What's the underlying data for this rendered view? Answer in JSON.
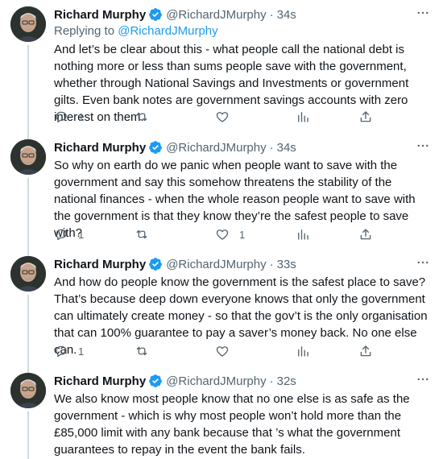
{
  "author": {
    "name": "Richard Murphy",
    "handle": "@RichardJMurphy"
  },
  "tweets": [
    {
      "time": "34s",
      "replying_label": "Replying to",
      "replying_to": "@RichardJMurphy",
      "text": "And let’s be clear about this - what people call the national debt is nothing more or less than sums people save with the government, whether through National Savings and Investments or government gilts. Even bank notes are government savings accounts with zero interest on them.",
      "replies": "1",
      "retweets": "",
      "likes": ""
    },
    {
      "time": "34s",
      "text": "So why on earth do we panic when people want to save with the government and say this somehow threatens the stability of the national finances - when the whole reason people want to save with the government is that they know they’re the safest people to save with?",
      "replies": "1",
      "retweets": "",
      "likes": "1"
    },
    {
      "time": "33s",
      "text": "And how do people know the government is the safest place to save? That’s because deep down everyone knows that only the government can ultimately create money - so that the gov’t is the only organisation that can 100% guarantee to pay a saver’s money back. No one else can.",
      "replies": "1",
      "retweets": "",
      "likes": ""
    },
    {
      "time": "32s",
      "text": "We also know most people know that no one else is as safe as the government - which is why most people won’t hold more than the £85,000 limit with any bank because that ’s what the government guarantees to repay in the event the bank fails.",
      "replies": "",
      "retweets": "",
      "likes": ""
    }
  ],
  "icons": {
    "verified": "verified-badge-icon",
    "more": "more-icon",
    "reply": "reply-icon",
    "retweet": "retweet-icon",
    "like": "like-icon",
    "analytics": "analytics-icon",
    "share": "share-icon"
  },
  "colors": {
    "accent": "#1d9bf0",
    "secondary_text": "#536471",
    "primary_text": "#0f1419"
  }
}
